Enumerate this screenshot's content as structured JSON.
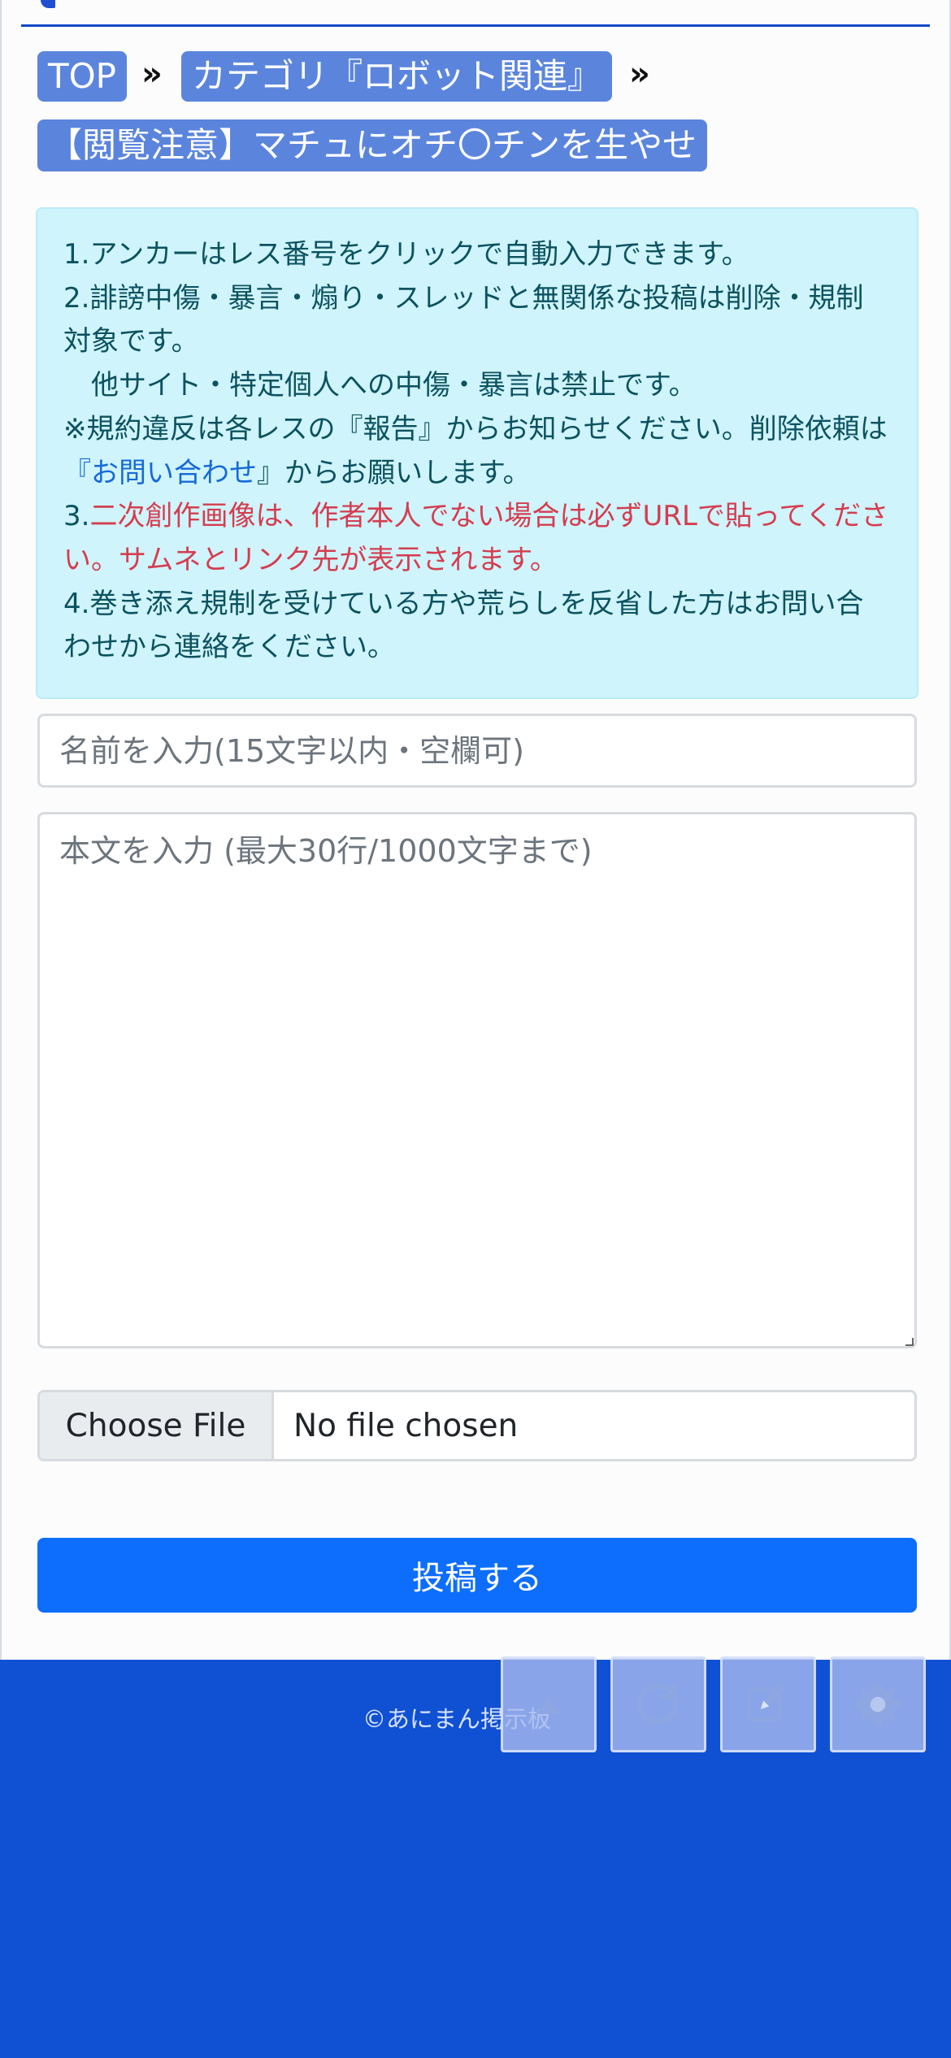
{
  "breadcrumb": {
    "top_label": "TOP",
    "category_label": "カテゴリ『ロボット関連』",
    "separator": "»",
    "thread_label": "【閲覧注意】マチュにオチ〇チンを生やせ"
  },
  "notice": {
    "line1": "1.アンカーはレス番号をクリックで自動入力できます。",
    "line2a": "2.誹謗中傷・暴言・煽り・スレッドと無関係な投稿は削除・規制対象です。",
    "line2b": "他サイト・特定個人への中傷・暴言は禁止です。",
    "line3_prefix": "※規約違反は各レスの『報告』からお知らせください。削除依頼は",
    "line3_link_open": "『",
    "line3_link": "お問い合わせ",
    "line3_link_close": "』",
    "line3_suffix": "からお願いします。",
    "line4_prefix": "3.",
    "line4_red": "二次創作画像は、作者本人でない場合は必ずURLで貼ってください。サムネとリンク先が表示されます。",
    "line5": "4.巻き添え規制を受けている方や荒らしを反省した方はお問い合わせから連絡をください。"
  },
  "form": {
    "name_placeholder": "名前を入力(15文字以内・空欄可)",
    "body_placeholder": "本文を入力 (最大30行/1000文字まで)",
    "file_button_label": "Choose File",
    "file_status": "No file chosen",
    "submit_label": "投稿する"
  },
  "footer": {
    "copyright": "©あにまん掲示板"
  },
  "toolbar": {
    "icons": [
      "up-icon",
      "refresh-icon",
      "edit-icon",
      "gear-icon"
    ]
  },
  "colors": {
    "breadcrumb_pill": "#5b85dd",
    "notice_background": "#cff4fb",
    "notice_text": "#0c5260",
    "notice_red": "#d53d4f",
    "link": "#166ad8",
    "submit": "#0d6efd",
    "footer_background": "#1050d3"
  }
}
